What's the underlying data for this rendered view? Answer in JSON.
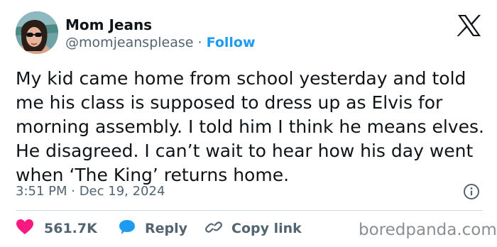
{
  "author": {
    "name": "Mom Jeans",
    "handle": "@momjeansplease",
    "separator": "·",
    "follow_label": "Follow"
  },
  "tweet": {
    "text": "My kid came home from school yesterday and told me his class is supposed to dress up as Elvis for morning assembly. I told him I think he means elves. He disagreed. I can’t wait to hear how his day went when ‘The King’ returns home.",
    "timestamp": "3:51 PM · Dec 19, 2024"
  },
  "actions": {
    "like_count": "561.7K",
    "reply_label": "Reply",
    "copy_link_label": "Copy link"
  },
  "watermark": "boredpanda.com",
  "icons": {
    "platform": "x-logo-icon",
    "info": "info-icon",
    "like": "heart-icon",
    "reply": "speech-bubble-icon",
    "copy": "link-icon"
  },
  "colors": {
    "text_primary": "#0f1419",
    "text_secondary": "#536471",
    "accent": "#1d9bf0",
    "like": "#f91880",
    "divider": "#cfd9de"
  }
}
